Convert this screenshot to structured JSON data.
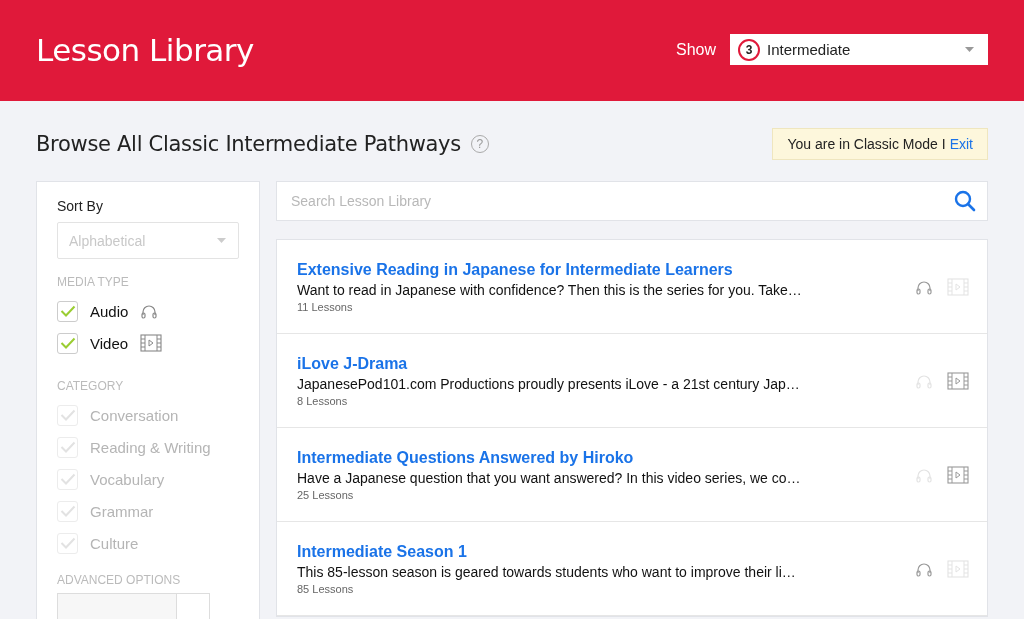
{
  "header": {
    "title": "Lesson Library",
    "show_label": "Show",
    "level_number": "3",
    "level_name": "Intermediate"
  },
  "page_title": "Browse All Classic Intermediate Pathways",
  "help_symbol": "?",
  "mode_notice": {
    "text": "You are in Classic Mode I",
    "link": "Exit"
  },
  "sidebar": {
    "sort_label": "Sort By",
    "sort_value": "Alphabetical",
    "sort_disabled": true,
    "media_heading": "MEDIA TYPE",
    "media": [
      {
        "label": "Audio",
        "checked": true,
        "disabled": false
      },
      {
        "label": "Video",
        "checked": true,
        "disabled": false
      }
    ],
    "category_heading": "CATEGORY",
    "categories": [
      {
        "label": "Conversation",
        "checked": true,
        "disabled": true
      },
      {
        "label": "Reading & Writing",
        "checked": true,
        "disabled": true
      },
      {
        "label": "Vocabulary",
        "checked": true,
        "disabled": true
      },
      {
        "label": "Grammar",
        "checked": true,
        "disabled": true
      },
      {
        "label": "Culture",
        "checked": true,
        "disabled": true
      }
    ],
    "advanced_heading": "ADVANCED OPTIONS"
  },
  "search": {
    "placeholder": "Search Lesson Library"
  },
  "series": [
    {
      "title": "Extensive Reading in Japanese for Intermediate Learners",
      "description": "Want to read in Japanese with confidence? Then this is the series for you. Take…",
      "count": "11 Lessons",
      "audio": true,
      "video": false
    },
    {
      "title": "iLove J-Drama",
      "description": "JapanesePod101.com Productions proudly presents iLove - a 21st century Jap…",
      "count": "8 Lessons",
      "audio": false,
      "video": true
    },
    {
      "title": "Intermediate Questions Answered by Hiroko",
      "description": "Have a Japanese question that you want answered? In this video series, we co…",
      "count": "25 Lessons",
      "audio": false,
      "video": true
    },
    {
      "title": "Intermediate Season 1",
      "description": "This 85-lesson season is geared towards students who want to improve their li…",
      "count": "85 Lessons",
      "audio": true,
      "video": false
    }
  ]
}
